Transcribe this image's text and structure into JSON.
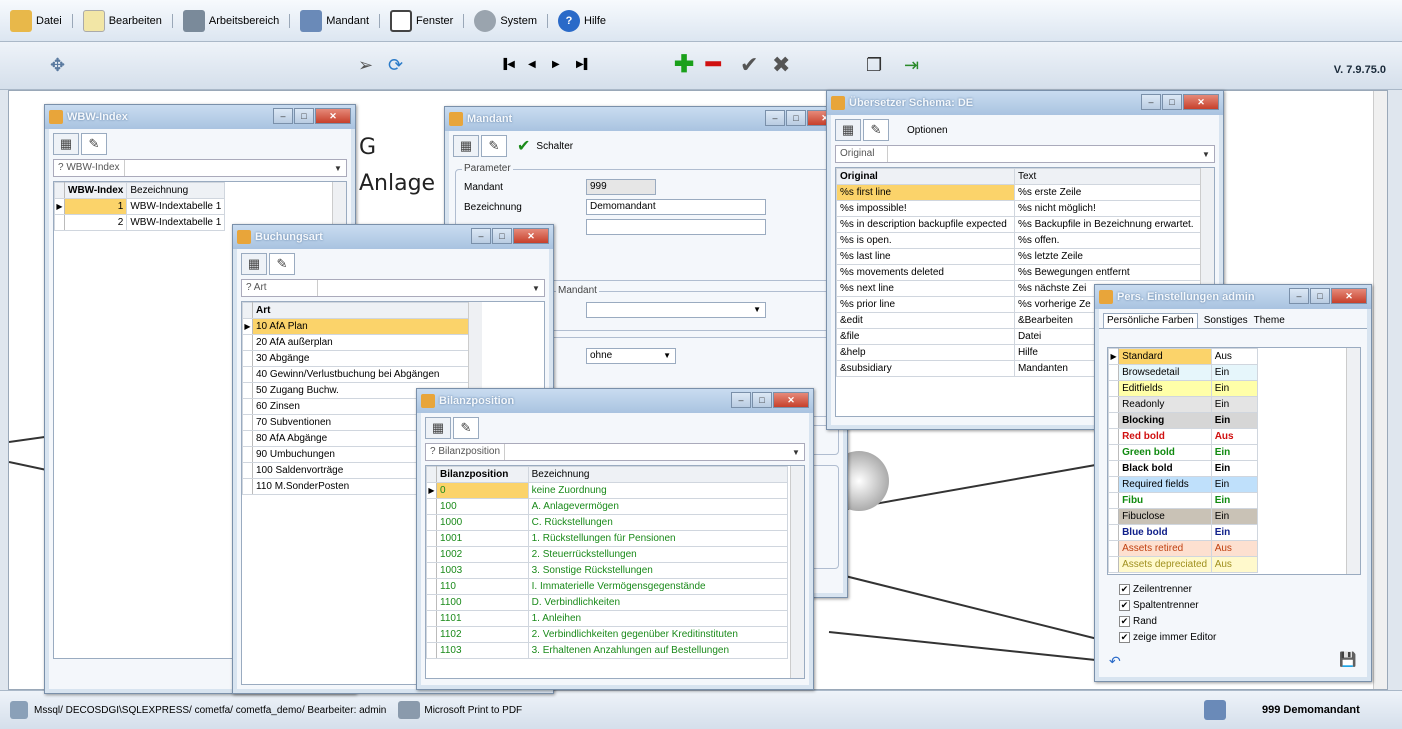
{
  "menu": {
    "items": [
      "Datei",
      "Bearbeiten",
      "Arbeitsbereich",
      "Mandant",
      "Fenster",
      "System",
      "Hilfe"
    ]
  },
  "toolbar": {
    "version": "V. 7.9.75.0"
  },
  "background": {
    "text1": "G",
    "text2": "Anlage"
  },
  "status": {
    "connection": "Mssql/ DECOSDGI\\SQLEXPRESS/ cometfa/ cometfa_demo/ Bearbeiter: admin",
    "printer": "Microsoft Print to PDF",
    "mandant": "999  Demomandant"
  },
  "wbw": {
    "title": "WBW-Index",
    "filter_label": "? WBW-Index",
    "columns": [
      "WBW-Index",
      "Bezeichnung"
    ],
    "rows": [
      {
        "index": "1",
        "name": "WBW-Indextabelle 1"
      },
      {
        "index": "2",
        "name": "WBW-Indextabelle 1"
      }
    ]
  },
  "mandant": {
    "title": "Mandant",
    "schalter": "Schalter",
    "group_parameter": "Parameter",
    "label_mandant": "Mandant",
    "value_mandant": "999",
    "label_bezeichnung": "Bezeichnung",
    "value_bezeichnung": "Demomandant",
    "group_mandant": "Mandant",
    "select_value": "ohne"
  },
  "buchungsart": {
    "title": "Buchungsart",
    "filter_label": "? Art",
    "column": "Art",
    "rows": [
      "10 AfA Plan",
      "20 AfA außerplan",
      "30 Abgänge",
      "40 Gewinn/Verlustbuchung bei Abgängen",
      "50 Zugang Buchw.",
      "60 Zinsen",
      "70 Subventionen",
      "80 AfA Abgänge",
      "90 Umbuchungen",
      "100 Saldenvorträge",
      "110 M.SonderPosten"
    ]
  },
  "bilanz": {
    "title": "Bilanzposition",
    "filter_label": "? Bilanzposition",
    "columns": [
      "Bilanzposition",
      "Bezeichnung"
    ],
    "rows": [
      {
        "pos": "0",
        "name": "keine Zuordnung"
      },
      {
        "pos": "100",
        "name": "A. Anlagevermögen"
      },
      {
        "pos": "1000",
        "name": "C. Rückstellungen"
      },
      {
        "pos": "1001",
        "name": "1. Rückstellungen für Pensionen"
      },
      {
        "pos": "1002",
        "name": "2. Steuerrückstellungen"
      },
      {
        "pos": "1003",
        "name": "3. Sonstige Rückstellungen"
      },
      {
        "pos": "110",
        "name": "I. Immaterielle Vermögensgegenstände"
      },
      {
        "pos": "1100",
        "name": "D. Verbindlichkeiten"
      },
      {
        "pos": "1101",
        "name": "1. Anleihen"
      },
      {
        "pos": "1102",
        "name": "2. Verbindlichkeiten gegenüber Kreditinstituten"
      },
      {
        "pos": "1103",
        "name": "3. Erhaltenen Anzahlungen auf Bestellungen"
      }
    ]
  },
  "uebersetzer": {
    "title": "Übersetzer Schema: DE",
    "optionen": "Optionen",
    "filter_label": "Original",
    "columns": [
      "Original",
      "Text"
    ],
    "rows": [
      {
        "orig": "%s first line",
        "text": "%s erste Zeile"
      },
      {
        "orig": "%s impossible!",
        "text": "%s nicht möglich!"
      },
      {
        "orig": "%s in description backupfile expected",
        "text": "%s Backupfile in Bezeichnung erwartet."
      },
      {
        "orig": "%s is open.",
        "text": "%s offen."
      },
      {
        "orig": "%s last line",
        "text": "%s letzte Zeile"
      },
      {
        "orig": "%s movements deleted",
        "text": "%s Bewegungen entfernt"
      },
      {
        "orig": "%s next line",
        "text": "%s nächste Zei"
      },
      {
        "orig": "%s prior line",
        "text": "%s vorherige Ze"
      },
      {
        "orig": "&edit",
        "text": "&Bearbeiten"
      },
      {
        "orig": "&file",
        "text": "Datei"
      },
      {
        "orig": "&help",
        "text": "Hilfe"
      },
      {
        "orig": "&subsidiary",
        "text": "Mandanten"
      }
    ]
  },
  "pers": {
    "title": "Pers. Einstellungen admin",
    "tabs": [
      "Persönliche Farben",
      "Sonstiges",
      "Theme"
    ],
    "rows": [
      {
        "name": "Standard",
        "val": "Aus",
        "bg": "#fbd36a",
        "vbg": "#ffffff",
        "color": "#000000",
        "bold": false
      },
      {
        "name": "Browsedetail",
        "val": "Ein",
        "bg": "#e6f6fb",
        "vbg": "#e6f6fb",
        "color": "#000000",
        "bold": false
      },
      {
        "name": "Editfields",
        "val": "Ein",
        "bg": "#ffffa8",
        "vbg": "#ffffa8",
        "color": "#000000",
        "bold": false
      },
      {
        "name": "Readonly",
        "val": "Ein",
        "bg": "#e4e4e4",
        "vbg": "#e4e4e4",
        "color": "#000000",
        "bold": false
      },
      {
        "name": "Blocking",
        "val": "Ein",
        "bg": "#d6d6d6",
        "vbg": "#d6d6d6",
        "color": "#000000",
        "bold": true
      },
      {
        "name": "Red bold",
        "val": "Aus",
        "bg": "#ffffff",
        "vbg": "#ffffff",
        "color": "#d01010",
        "bold": true
      },
      {
        "name": "Green bold",
        "val": "Ein",
        "bg": "#ffffff",
        "vbg": "#ffffff",
        "color": "#108a10",
        "bold": true
      },
      {
        "name": "Black bold",
        "val": "Ein",
        "bg": "#ffffff",
        "vbg": "#ffffff",
        "color": "#000000",
        "bold": true
      },
      {
        "name": "Required fields",
        "val": "Ein",
        "bg": "#bfe0fb",
        "vbg": "#bfe0fb",
        "color": "#000000",
        "bold": false
      },
      {
        "name": "Fibu",
        "val": "Ein",
        "bg": "#ffffff",
        "vbg": "#ffffff",
        "color": "#108a10",
        "bold": true
      },
      {
        "name": "Fibuclose",
        "val": "Ein",
        "bg": "#c9c2b6",
        "vbg": "#c9c2b6",
        "color": "#000000",
        "bold": false
      },
      {
        "name": "Blue bold",
        "val": "Ein",
        "bg": "#ffffff",
        "vbg": "#ffffff",
        "color": "#10208a",
        "bold": true
      },
      {
        "name": "Assets retired",
        "val": "Aus",
        "bg": "#fde0d0",
        "vbg": "#fde0d0",
        "color": "#c04010",
        "bold": false
      },
      {
        "name": "Assets depreciated",
        "val": "Aus",
        "bg": "#fff9cc",
        "vbg": "#fff9cc",
        "color": "#a09020",
        "bold": false
      }
    ],
    "checkboxes": [
      "Zeilentrenner",
      "Spaltentrenner",
      "Rand",
      "zeige immer Editor"
    ]
  }
}
